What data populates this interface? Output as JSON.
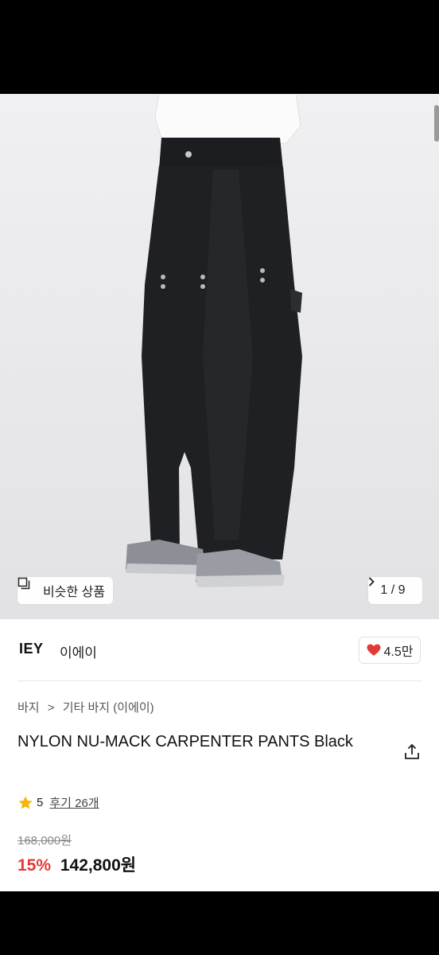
{
  "photo": {
    "similar_button_label": "비슷한 상품",
    "similar_icon": "copy-icon",
    "counter_label": "1 / 9",
    "counter_icon": "chevron-right-icon"
  },
  "brand": {
    "logo_text": "IEY",
    "name": "이에이",
    "like_count": "4.5만",
    "like_icon": "heart-icon",
    "like_color": "#e53935"
  },
  "breadcrumb": {
    "items": [
      "바지",
      "기타 바지 (이에이)"
    ],
    "separator": ">"
  },
  "product": {
    "title": "NYLON NU-MACK CARPENTER PANTS Black",
    "share_icon": "share-icon",
    "rating_icon": "star-icon",
    "rating_color": "#f5b50a",
    "rating": "5",
    "reviews_label": "후기 26개",
    "original_price": "168,000원",
    "discount": "15%",
    "price": "142,800원",
    "discount_color": "#e53935"
  }
}
